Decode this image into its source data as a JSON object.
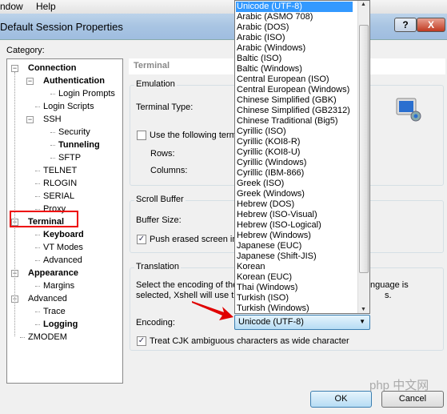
{
  "menubar": {
    "items": [
      "ndow",
      "Help"
    ]
  },
  "window": {
    "title": "Default Session Properties",
    "help_label": "?",
    "close_label": "X"
  },
  "category_label": "Category:",
  "tree": [
    {
      "label": "Connection",
      "level": 0,
      "bold": true,
      "expander": true
    },
    {
      "label": "Authentication",
      "level": 1,
      "bold": true,
      "expander": true
    },
    {
      "label": "Login Prompts",
      "level": 2
    },
    {
      "label": "Login Scripts",
      "level": 1
    },
    {
      "label": "SSH",
      "level": 1,
      "expander": true
    },
    {
      "label": "Security",
      "level": 2
    },
    {
      "label": "Tunneling",
      "level": 2,
      "bold": true
    },
    {
      "label": "SFTP",
      "level": 2
    },
    {
      "label": "TELNET",
      "level": 1
    },
    {
      "label": "RLOGIN",
      "level": 1
    },
    {
      "label": "SERIAL",
      "level": 1
    },
    {
      "label": "Proxy",
      "level": 1
    },
    {
      "label": "Terminal",
      "level": 0,
      "bold": true,
      "expander": true,
      "selected": true
    },
    {
      "label": "Keyboard",
      "level": 1,
      "bold": true
    },
    {
      "label": "VT Modes",
      "level": 1
    },
    {
      "label": "Advanced",
      "level": 1
    },
    {
      "label": "Appearance",
      "level": 0,
      "bold": true,
      "expander": true
    },
    {
      "label": "Margins",
      "level": 1
    },
    {
      "label": "Advanced",
      "level": 0,
      "expander": true
    },
    {
      "label": "Trace",
      "level": 1
    },
    {
      "label": "Logging",
      "level": 1,
      "bold": true
    },
    {
      "label": "ZMODEM",
      "level": 0
    }
  ],
  "section_title": "Terminal",
  "emulation": {
    "title": "Emulation",
    "terminal_type_label": "Terminal Type:",
    "use_following_label": "Use the following term",
    "use_following_checked": false,
    "rows_label": "Rows:",
    "columns_label": "Columns:"
  },
  "scroll_buffer": {
    "title": "Scroll Buffer",
    "buffer_size_label": "Buffer Size:",
    "push_erased_label": "Push erased screen int",
    "push_erased_checked": true
  },
  "translation": {
    "title": "Translation",
    "desc_line1": "Select the encoding of the",
    "desc_line1_tail": "nguage is",
    "desc_line2": "selected, Xshell will use th",
    "desc_line2_tail": "s.",
    "encoding_label": "Encoding:",
    "encoding_value": "Unicode (UTF-8)",
    "cjk_label": "Treat CJK ambiguous characters as wide character",
    "cjk_checked": true
  },
  "encoding_options": [
    "Unicode (UTF-8)",
    "Arabic (ASMO 708)",
    "Arabic (DOS)",
    "Arabic (ISO)",
    "Arabic (Windows)",
    "Baltic (ISO)",
    "Baltic (Windows)",
    "Central European (ISO)",
    "Central European (Windows)",
    "Chinese Simplified (GBK)",
    "Chinese Simplified (GB2312)",
    "Chinese Traditional (Big5)",
    "Cyrillic (ISO)",
    "Cyrillic (KOI8-R)",
    "Cyrillic (KOI8-U)",
    "Cyrillic (Windows)",
    "Cyrillic (IBM-866)",
    "Greek (ISO)",
    "Greek (Windows)",
    "Hebrew (DOS)",
    "Hebrew (ISO-Visual)",
    "Hebrew (ISO-Logical)",
    "Hebrew (Windows)",
    "Japanese (EUC)",
    "Japanese (Shift-JIS)",
    "Korean",
    "Korean (EUC)",
    "Thai (Windows)",
    "Turkish (ISO)",
    "Turkish (Windows)"
  ],
  "buttons": {
    "ok": "OK",
    "cancel": "Cancel"
  },
  "watermark": "php 中文网",
  "colors": {
    "highlight_box": "#e00000",
    "arrow": "#e00000",
    "selection": "#3399ff"
  }
}
